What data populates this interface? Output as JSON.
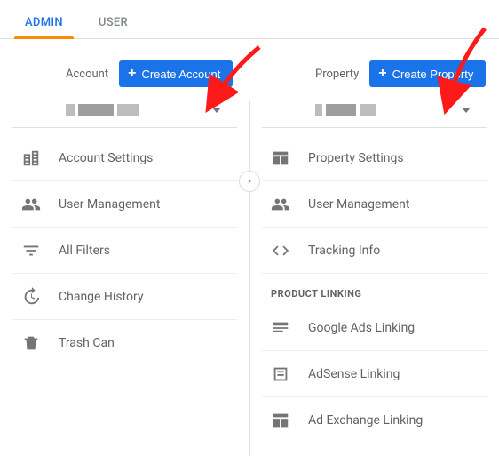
{
  "tabs": {
    "admin": "ADMIN",
    "user": "USER"
  },
  "account": {
    "label": "Account",
    "create_label": "Create Account",
    "items": [
      {
        "label": "Account Settings"
      },
      {
        "label": "User Management"
      },
      {
        "label": "All Filters"
      },
      {
        "label": "Change History"
      },
      {
        "label": "Trash Can"
      }
    ]
  },
  "property": {
    "label": "Property",
    "create_label": "Create Property",
    "items": [
      {
        "label": "Property Settings"
      },
      {
        "label": "User Management"
      },
      {
        "label": "Tracking Info"
      }
    ],
    "product_section": "PRODUCT LINKING",
    "product_items": [
      {
        "label": "Google Ads Linking"
      },
      {
        "label": "AdSense Linking"
      },
      {
        "label": "Ad Exchange Linking"
      }
    ]
  }
}
